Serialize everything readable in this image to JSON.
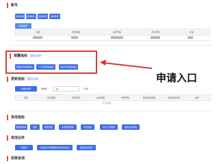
{
  "account": {
    "title": "账号",
    "buttons": [
      "修改密码",
      "修改联系人",
      "退出登录",
      "我的账号"
    ],
    "table_tag": "我的账号",
    "columns": [
      "姓名",
      "证件类型",
      "证件号码",
      "手机号码",
      "状态"
    ]
  },
  "quota": {
    "title": "增量指标",
    "sub": "操作说明",
    "buttons": [
      "家庭申请增量指标",
      "个人申请增量指标",
      "单位申请增量指标"
    ]
  },
  "renewal": {
    "title": "更新指标",
    "sub": "操作说明",
    "search_button": "选择车牌号",
    "plate_label": "车牌号",
    "plate_value": "粤",
    "query_button": "查询",
    "columns": [
      "名称",
      "证件类型",
      "证件号码",
      "业务类型",
      "号牌号码",
      "新能源车类型",
      "有效截至时间",
      "操作"
    ],
    "no_data": "暂无数据"
  },
  "other_quota": {
    "title": "其他指标",
    "buttons": [
      "新能源指标",
      "更新",
      "调整变更",
      "夫妻变更更新",
      "司法拍卖",
      "外省人员更新",
      "其他业务申请"
    ]
  },
  "other_business": {
    "title": "其他业务",
    "buttons": [
      "新能源",
      "混合动力车辆更新指标申请业务",
      "更新指标变更"
    ]
  },
  "policy": {
    "title": "政策咨询"
  },
  "annotation": {
    "label": "申请入口",
    "color": "#d33a36"
  }
}
